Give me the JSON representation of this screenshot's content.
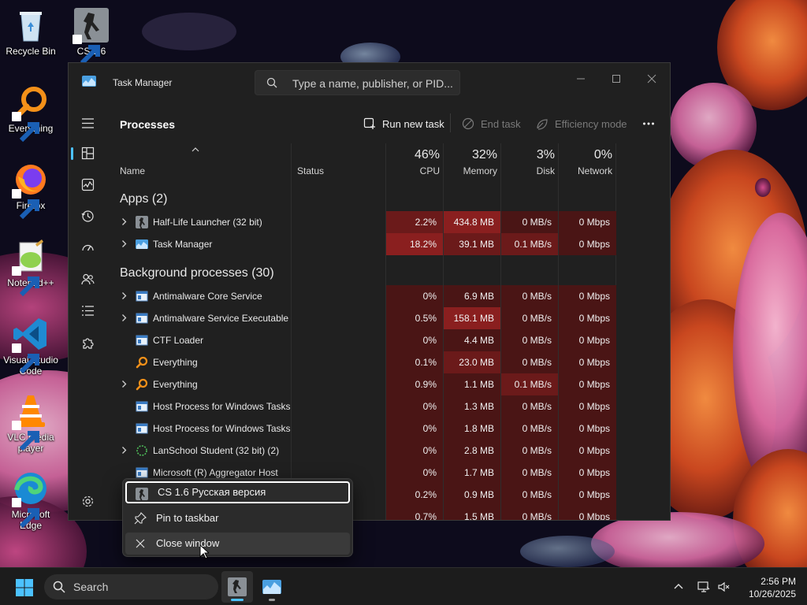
{
  "desktop": {
    "icons": [
      {
        "label": "Recycle Bin",
        "icon": "recycle-bin-icon"
      },
      {
        "label": "CS 1.6\nR...",
        "icon": "counter-strike-icon"
      },
      {
        "label": "Everything",
        "icon": "everything-search-icon"
      },
      {
        "label": "Firefox",
        "icon": "firefox-icon"
      },
      {
        "label": "Notepad++",
        "icon": "notepad-plus-plus-icon"
      },
      {
        "label": "Visual Studio Code",
        "icon": "vscode-icon"
      },
      {
        "label": "VLC media player",
        "icon": "vlc-icon"
      },
      {
        "label": "Microsoft Edge",
        "icon": "edge-icon"
      }
    ]
  },
  "window": {
    "title": "Task Manager",
    "search_placeholder": "Type a name, publisher, or PID..."
  },
  "toolbar": {
    "heading": "Processes",
    "run_new_task": "Run new task",
    "end_task": "End task",
    "efficiency_mode": "Efficiency mode"
  },
  "columns": {
    "name": "Name",
    "status": "Status",
    "cpu": {
      "pct": "46%",
      "label": "CPU"
    },
    "memory": {
      "pct": "32%",
      "label": "Memory"
    },
    "disk": {
      "pct": "3%",
      "label": "Disk"
    },
    "network": {
      "pct": "0%",
      "label": "Network"
    }
  },
  "groups": {
    "apps": "Apps (2)",
    "background": "Background processes (30)"
  },
  "apps": [
    {
      "name": "Half-Life Launcher (32 bit)",
      "cpu": "2.2%",
      "mem": "434.8 MB",
      "disk": "0 MB/s",
      "net": "0 Mbps",
      "expandable": true,
      "icon": "half-life-icon"
    },
    {
      "name": "Task Manager",
      "cpu": "18.2%",
      "mem": "39.1 MB",
      "disk": "0.1 MB/s",
      "net": "0 Mbps",
      "expandable": true,
      "icon": "task-manager-icon"
    }
  ],
  "background": [
    {
      "name": "Antimalware Core Service",
      "cpu": "0%",
      "mem": "6.9 MB",
      "disk": "0 MB/s",
      "net": "0 Mbps",
      "expandable": true,
      "icon": "service-window-icon"
    },
    {
      "name": "Antimalware Service Executable",
      "cpu": "0.5%",
      "mem": "158.1 MB",
      "disk": "0 MB/s",
      "net": "0 Mbps",
      "expandable": true,
      "icon": "service-window-icon"
    },
    {
      "name": "CTF Loader",
      "cpu": "0%",
      "mem": "4.4 MB",
      "disk": "0 MB/s",
      "net": "0 Mbps",
      "expandable": false,
      "icon": "service-window-icon"
    },
    {
      "name": "Everything",
      "cpu": "0.1%",
      "mem": "23.0 MB",
      "disk": "0 MB/s",
      "net": "0 Mbps",
      "expandable": false,
      "icon": "everything-search-icon"
    },
    {
      "name": "Everything",
      "cpu": "0.9%",
      "mem": "1.1 MB",
      "disk": "0.1 MB/s",
      "net": "0 Mbps",
      "expandable": true,
      "icon": "everything-search-icon"
    },
    {
      "name": "Host Process for Windows Tasks",
      "cpu": "0%",
      "mem": "1.3 MB",
      "disk": "0 MB/s",
      "net": "0 Mbps",
      "expandable": false,
      "icon": "service-window-icon"
    },
    {
      "name": "Host Process for Windows Tasks",
      "cpu": "0%",
      "mem": "1.8 MB",
      "disk": "0 MB/s",
      "net": "0 Mbps",
      "expandable": false,
      "icon": "service-window-icon"
    },
    {
      "name": "LanSchool Student (32 bit) (2)",
      "cpu": "0%",
      "mem": "2.8 MB",
      "disk": "0 MB/s",
      "net": "0 Mbps",
      "expandable": true,
      "icon": "lanschool-icon"
    },
    {
      "name": "Microsoft (R) Aggregator Host",
      "cpu": "0%",
      "mem": "1.7 MB",
      "disk": "0 MB/s",
      "net": "0 Mbps",
      "expandable": false,
      "icon": "service-window-icon"
    },
    {
      "name": "",
      "cpu": "0.2%",
      "mem": "0.9 MB",
      "disk": "0 MB/s",
      "net": "0 Mbps",
      "expandable": false,
      "icon": ""
    },
    {
      "name": "",
      "cpu": "0.7%",
      "mem": "1.5 MB",
      "disk": "0 MB/s",
      "net": "0 Mbps",
      "expandable": false,
      "icon": ""
    }
  ],
  "jumplist": {
    "app_title": "CS 1.6 Русская версия",
    "pin": "Pin to taskbar",
    "close": "Close window"
  },
  "taskbar": {
    "search_label": "Search",
    "time": "2:56 PM",
    "date": "10/26/2025"
  },
  "colors": {
    "accent": "#4cc2ff",
    "heat_high": "#8a1f1f",
    "heat_mid": "#6b1a1a",
    "heat_low": "#4a1515",
    "window_bg": "#202020"
  }
}
